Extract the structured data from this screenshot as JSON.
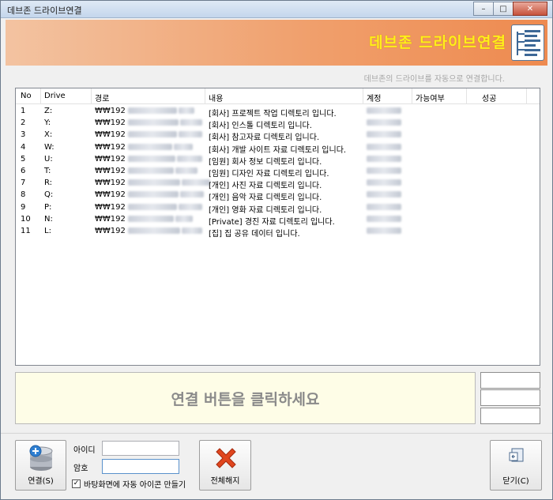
{
  "window": {
    "title": "데브존 드라이브연결"
  },
  "banner": {
    "title": "데브존 드라이브연결",
    "subtitle": "데브존의 드라이브를 자동으로 연결합니다."
  },
  "table": {
    "columns": [
      "No",
      "Drive",
      "경로",
      "내용",
      "계정",
      "가능여부",
      "성공"
    ],
    "rows": [
      {
        "no": "1",
        "drive": "Z:",
        "path": "₩₩192",
        "desc": "[회사] 프로젝트 작업 디렉토리 입니다."
      },
      {
        "no": "2",
        "drive": "Y:",
        "path": "₩₩192",
        "desc": "[회사] 인스톨 디렉토리 입니다."
      },
      {
        "no": "3",
        "drive": "X:",
        "path": "₩₩192",
        "desc": "[회사] 참고자료 디렉토리 입니다."
      },
      {
        "no": "4",
        "drive": "W:",
        "path": "₩₩192",
        "desc": "[회사] 개발 사이트 자료 디렉토리 입니다."
      },
      {
        "no": "5",
        "drive": "U:",
        "path": "₩₩192",
        "desc": "[임원] 회사 정보 디렉토리 입니다."
      },
      {
        "no": "6",
        "drive": "T:",
        "path": "₩₩192",
        "desc": "[임원] 디자인 자료 디렉토리 입니다."
      },
      {
        "no": "7",
        "drive": "R:",
        "path": "₩₩192",
        "desc": "[개인] 사진 자료 디렉토리 입니다."
      },
      {
        "no": "8",
        "drive": "Q:",
        "path": "₩₩192",
        "desc": "[개인] 음악 자료 디렉토리 입니다."
      },
      {
        "no": "9",
        "drive": "P:",
        "path": "₩₩192",
        "desc": "[개인] 영화 자료 디렉토리 입니다."
      },
      {
        "no": "10",
        "drive": "N:",
        "path": "₩₩192",
        "desc": "[Private] 경진 자료 디렉토리 입니다."
      },
      {
        "no": "11",
        "drive": "L:",
        "path": "₩₩192",
        "desc": "[집] 집 공유 데이터 입니다."
      }
    ]
  },
  "status": {
    "message": "연결 버튼을 클릭하세요"
  },
  "form": {
    "id_label": "아이디",
    "pw_label": "암호",
    "id_value": "",
    "pw_value": "",
    "shortcut_label": "바탕화면에 자동 아이콘 만들기",
    "shortcut_checked": true
  },
  "buttons": {
    "connect": "연결(S)",
    "disconnect_all": "전체해지",
    "close": "닫기(C)"
  },
  "colors": {
    "banner_title": "#ffef1a",
    "banner_bg": "#f0a06d",
    "status_bg": "#fefde7"
  }
}
